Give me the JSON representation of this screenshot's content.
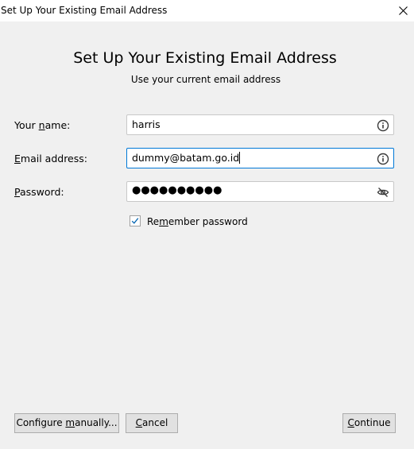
{
  "window": {
    "title": "Set Up Your Existing Email Address"
  },
  "header": {
    "title": "Set Up Your Existing Email Address",
    "subtitle": "Use your current email address"
  },
  "form": {
    "name": {
      "label_before": "Your ",
      "label_accel": "n",
      "label_after": "ame:",
      "value": "harris",
      "icon": "info-icon"
    },
    "email": {
      "label_before": "",
      "label_accel": "E",
      "label_after": "mail address:",
      "value": "dummy@batam.go.id",
      "icon": "info-icon"
    },
    "password": {
      "label_before": "",
      "label_accel": "P",
      "label_after": "assword:",
      "value": "●●●●●●●●●●",
      "icon": "eye-slash-icon"
    },
    "remember": {
      "label_before": "Re",
      "label_accel": "m",
      "label_after": "ember password",
      "checked": true
    }
  },
  "buttons": {
    "configure": {
      "label_before": "Configure ",
      "label_accel": "m",
      "label_after": "anually..."
    },
    "cancel": {
      "label_before": "",
      "label_accel": "C",
      "label_after": "ancel"
    },
    "continue": {
      "label_before": "",
      "label_accel": "C",
      "label_after": "ontinue"
    }
  },
  "colors": {
    "background": "#f0f0f0",
    "focus_border": "#0078d7",
    "checkmark": "#0063b1"
  }
}
